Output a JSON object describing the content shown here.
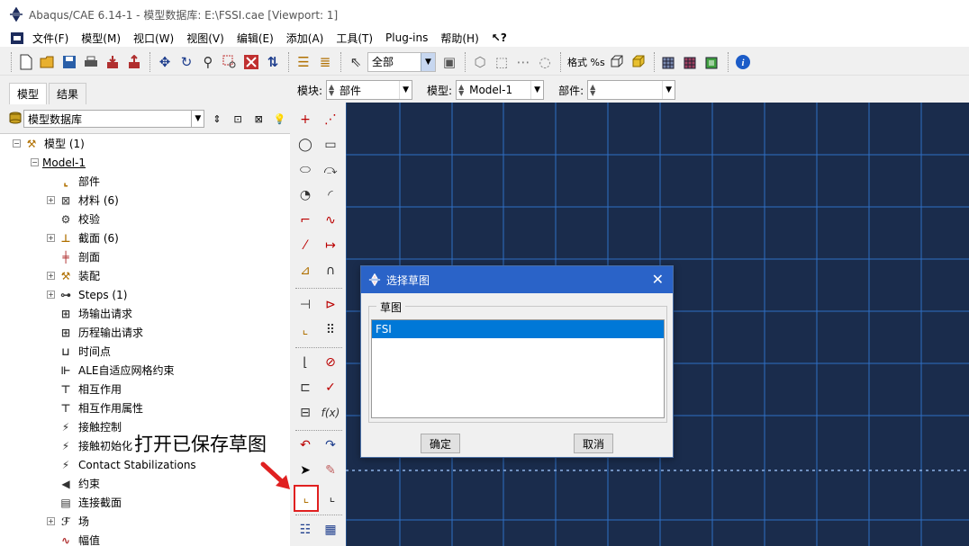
{
  "window": {
    "title": "Abaqus/CAE 6.14-1 - 模型数据库: E:\\FSSI.cae [Viewport: 1]"
  },
  "menubar": {
    "items": [
      "文件(F)",
      "模型(M)",
      "视口(W)",
      "视图(V)",
      "编辑(E)",
      "添加(A)",
      "工具(T)",
      "Plug-ins",
      "帮助(H)",
      "↖?"
    ]
  },
  "toolbar": {
    "filter_combo": "全部",
    "format_label": "格式 %s"
  },
  "left_panel": {
    "tabs": [
      "模型",
      "结果"
    ],
    "active_tab": "模型",
    "database_select": "模型数据库",
    "tree": [
      {
        "label": "模型 (1)",
        "level": 0,
        "expander": "-"
      },
      {
        "label": "Model-1",
        "level": 1,
        "expander": "-"
      },
      {
        "label": "部件",
        "level": 2,
        "expander": ""
      },
      {
        "label": "材料 (6)",
        "level": 2,
        "expander": "+"
      },
      {
        "label": "校验",
        "level": 2,
        "expander": ""
      },
      {
        "label": "截面 (6)",
        "level": 2,
        "expander": "+"
      },
      {
        "label": "剖面",
        "level": 2,
        "expander": ""
      },
      {
        "label": "装配",
        "level": 2,
        "expander": "+"
      },
      {
        "label": "Steps (1)",
        "level": 2,
        "expander": "+"
      },
      {
        "label": "场输出请求",
        "level": 2,
        "expander": ""
      },
      {
        "label": "历程输出请求",
        "level": 2,
        "expander": ""
      },
      {
        "label": "时间点",
        "level": 2,
        "expander": ""
      },
      {
        "label": "ALE自适应网格约束",
        "level": 2,
        "expander": ""
      },
      {
        "label": "相互作用",
        "level": 2,
        "expander": ""
      },
      {
        "label": "相互作用属性",
        "level": 2,
        "expander": ""
      },
      {
        "label": "接触控制",
        "level": 2,
        "expander": ""
      },
      {
        "label": "接触初始化",
        "level": 2,
        "expander": ""
      },
      {
        "label": "Contact Stabilizations",
        "level": 2,
        "expander": ""
      },
      {
        "label": "约束",
        "level": 2,
        "expander": ""
      },
      {
        "label": "连接截面",
        "level": 2,
        "expander": ""
      },
      {
        "label": "场",
        "level": 2,
        "expander": "+"
      },
      {
        "label": "幅值",
        "level": 2,
        "expander": ""
      }
    ]
  },
  "annotation": {
    "text": "打开已保存草图"
  },
  "module_bar": {
    "module_label": "模块:",
    "module_value": "部件",
    "model_label": "模型:",
    "model_value": "Model-1",
    "part_label": "部件:",
    "part_value": ""
  },
  "palette": {
    "fx_label": "f(x)"
  },
  "dialog": {
    "title": "选择草图",
    "group_label": "草图",
    "items": [
      "FSI"
    ],
    "selected_index": 0,
    "ok_label": "确定",
    "cancel_label": "取消"
  },
  "colors": {
    "viewport_bg": "#1a2c4c",
    "grid_line": "#2f6fc4",
    "dialog_title": "#2a63c8",
    "selection": "#0078d7",
    "annotation_arrow": "#e02020"
  }
}
